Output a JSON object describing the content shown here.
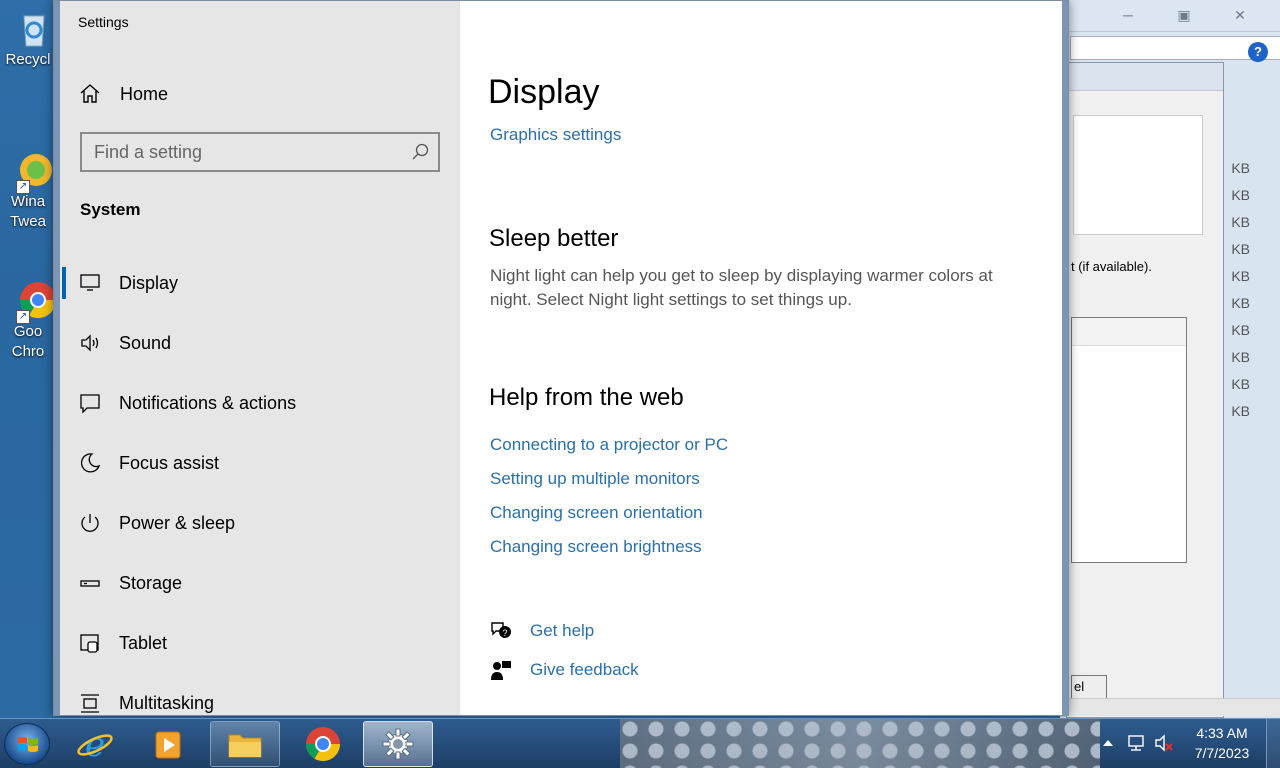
{
  "desktop": {
    "icons": [
      {
        "label": "Recycl",
        "icon": "recycle-bin-icon"
      },
      {
        "label": "Wina\nTwea",
        "icon": "winaero-tweaker-icon"
      },
      {
        "label": "Goo\nChro",
        "icon": "google-chrome-icon"
      }
    ]
  },
  "background_window": {
    "help_label": "?",
    "available_text": "t (if available).",
    "cancel_fragment": "el",
    "sizes": [
      "KB",
      "KB",
      "KB",
      "KB",
      "KB",
      "KB",
      "KB",
      "KB",
      "KB",
      "KB"
    ]
  },
  "settings": {
    "app_title": "Settings",
    "home_label": "Home",
    "search_placeholder": "Find a setting",
    "section_label": "System",
    "nav_items": [
      {
        "label": "Display",
        "icon": "monitor-icon",
        "active": true
      },
      {
        "label": "Sound",
        "icon": "speaker-icon"
      },
      {
        "label": "Notifications & actions",
        "icon": "notification-icon"
      },
      {
        "label": "Focus assist",
        "icon": "moon-icon"
      },
      {
        "label": "Power & sleep",
        "icon": "power-icon"
      },
      {
        "label": "Storage",
        "icon": "storage-icon"
      },
      {
        "label": "Tablet",
        "icon": "tablet-icon"
      },
      {
        "label": "Multitasking",
        "icon": "multitasking-icon"
      }
    ],
    "content": {
      "page_title": "Display",
      "graphics_link": "Graphics settings",
      "sleep_heading": "Sleep better",
      "sleep_text": "Night light can help you get to sleep by displaying warmer colors at night. Select Night light settings to set things up.",
      "web_heading": "Help from the web",
      "web_links": [
        "Connecting to a projector or PC",
        "Setting up multiple monitors",
        "Changing screen orientation",
        "Changing screen brightness"
      ],
      "get_help": "Get help",
      "give_feedback": "Give feedback"
    },
    "colors": {
      "accent": "#0063b1",
      "link": "#2b6fa8",
      "sidebar_bg": "#e6e6e6"
    }
  },
  "taskbar": {
    "apps": [
      {
        "name": "Internet Explorer",
        "icon": "internet-explorer-icon"
      },
      {
        "name": "Media Player",
        "icon": "media-player-icon"
      },
      {
        "name": "File Explorer",
        "icon": "file-explorer-icon"
      },
      {
        "name": "Google Chrome",
        "icon": "chrome-icon"
      },
      {
        "name": "Settings",
        "icon": "gear-icon"
      }
    ],
    "clock_time": "4:33 AM",
    "clock_date": "7/7/2023"
  }
}
